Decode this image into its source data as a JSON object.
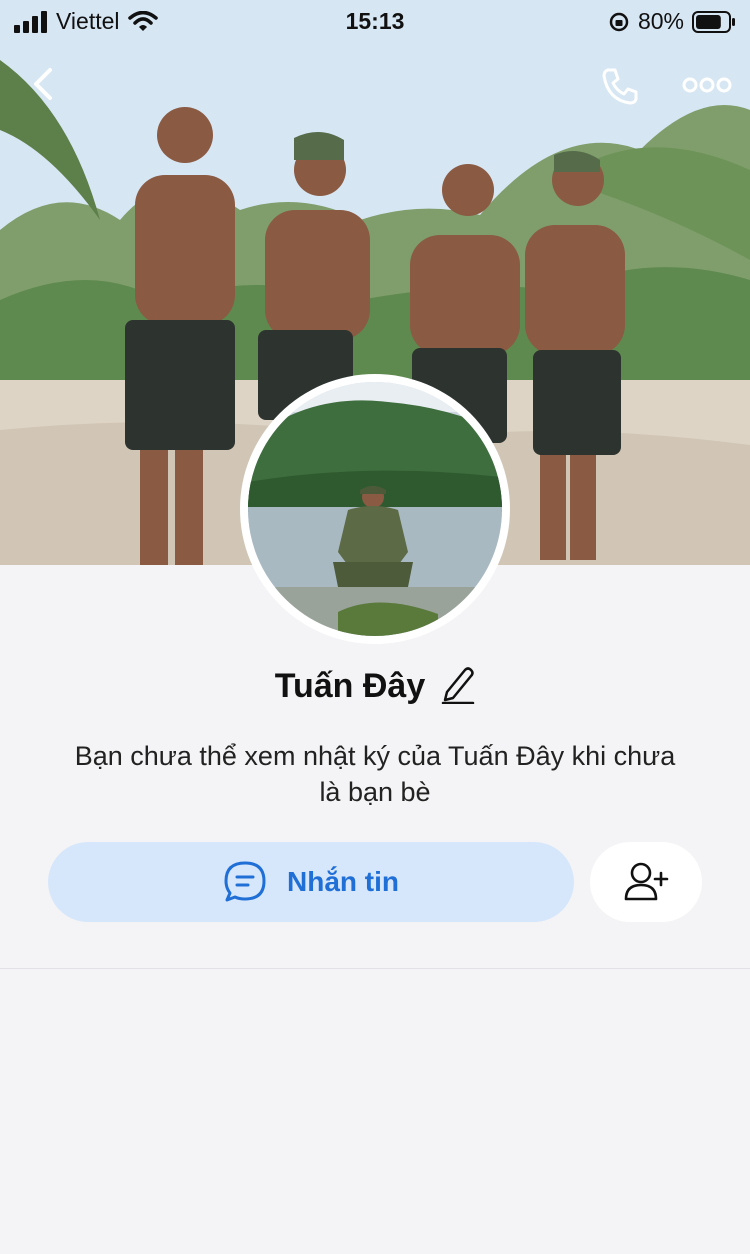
{
  "status_bar": {
    "carrier": "Viettel",
    "time": "15:13",
    "battery": "80%",
    "battery_level": 0.8
  },
  "profile": {
    "name": "Tuấn Đây",
    "notice": "Bạn chưa thể xem nhật ký của Tuấn Đây khi chưa là bạn bè"
  },
  "actions": {
    "message_label": "Nhắn tin"
  },
  "icons": {
    "back": "chevron-left-icon",
    "call": "phone-icon",
    "more": "more-icon",
    "edit": "pencil-icon",
    "message": "chat-bubble-icon",
    "add_friend": "add-user-icon"
  },
  "colors": {
    "accent": "#1f6fd6",
    "button_bg": "#d7e7fb",
    "page_bg": "#f4f4f6"
  }
}
